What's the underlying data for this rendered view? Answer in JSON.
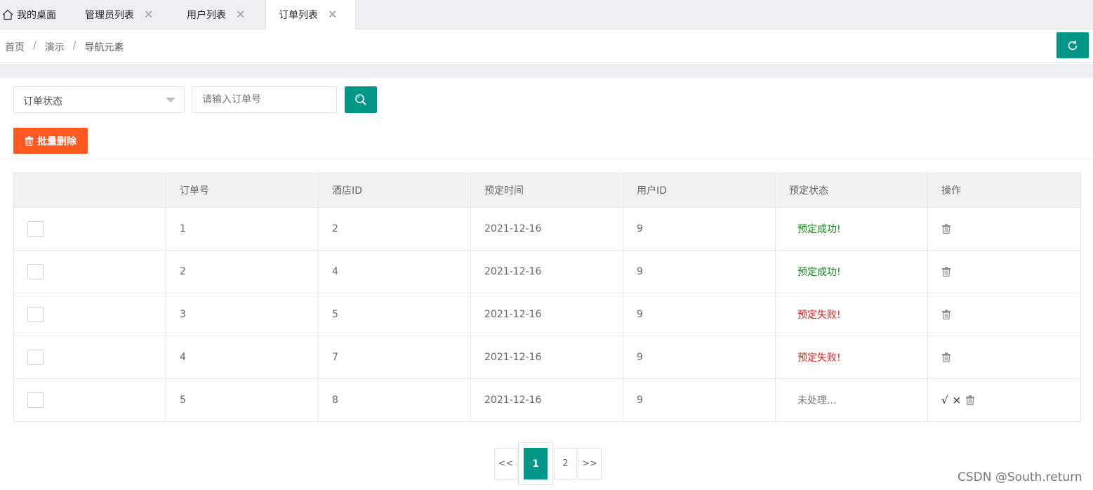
{
  "tabs": [
    {
      "label": "我的桌面",
      "closable": false,
      "active": false
    },
    {
      "label": "管理员列表",
      "closable": true,
      "active": false
    },
    {
      "label": "用户列表",
      "closable": true,
      "active": false
    },
    {
      "label": "订单列表",
      "closable": true,
      "active": true
    }
  ],
  "tab_close_glyph": "✕",
  "breadcrumb": {
    "items": [
      "首页",
      "演示",
      "导航元素"
    ],
    "separator": "/"
  },
  "search": {
    "status_select": "订单状态",
    "order_placeholder": "请输入订单号"
  },
  "toolbar": {
    "batch_delete_label": "批量删除"
  },
  "table": {
    "headers": [
      "",
      "订单号",
      "酒店ID",
      "预定时间",
      "用户ID",
      "预定状态",
      "操作"
    ],
    "rows": [
      {
        "order_no": "1",
        "hotel_id": "2",
        "time": "2021-12-16",
        "user_id": "9",
        "status": "预定成功!",
        "status_type": "success"
      },
      {
        "order_no": "2",
        "hotel_id": "4",
        "time": "2021-12-16",
        "user_id": "9",
        "status": "预定成功!",
        "status_type": "success"
      },
      {
        "order_no": "3",
        "hotel_id": "5",
        "time": "2021-12-16",
        "user_id": "9",
        "status": "预定失败!",
        "status_type": "fail"
      },
      {
        "order_no": "4",
        "hotel_id": "7",
        "time": "2021-12-16",
        "user_id": "9",
        "status": "预定失败!",
        "status_type": "fail"
      },
      {
        "order_no": "5",
        "hotel_id": "8",
        "time": "2021-12-16",
        "user_id": "9",
        "status": "未处理...",
        "status_type": "pending"
      }
    ],
    "approve_glyph": "√",
    "reject_glyph": "×"
  },
  "pagination": {
    "prev": "<<",
    "pages": [
      "1",
      "2"
    ],
    "current": "1",
    "next": ">>"
  },
  "watermark": "CSDN @South.return",
  "colors": {
    "primary": "#009688",
    "danger": "#ff5722",
    "success_text": "#0b8a12",
    "fail_text": "#e02020"
  }
}
